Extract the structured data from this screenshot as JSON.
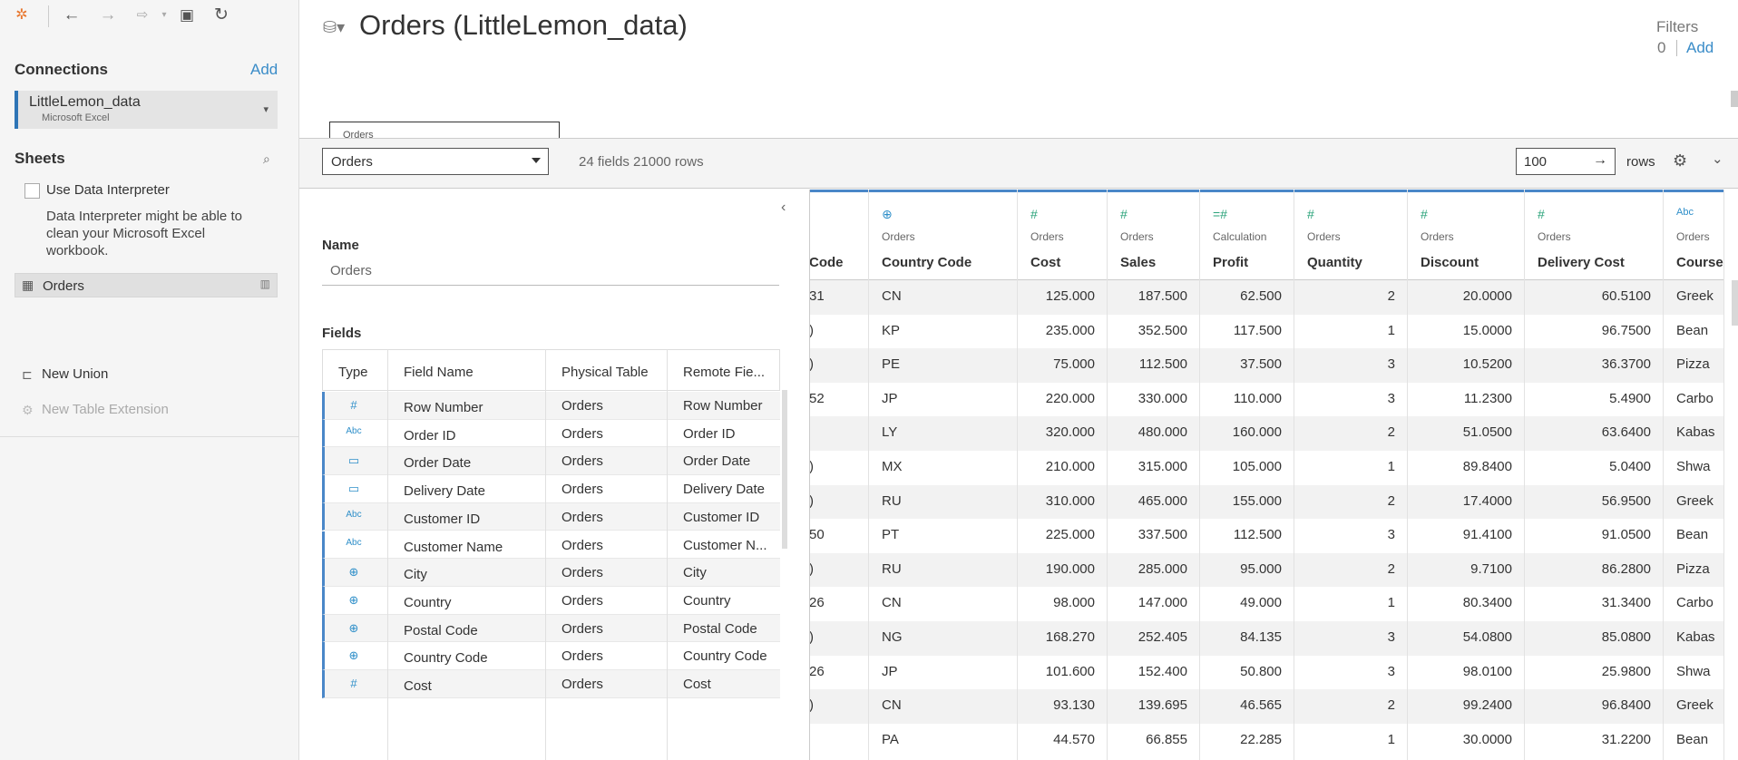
{
  "app": {
    "title": "Orders (LittleLemon_data)"
  },
  "left_panel": {
    "connections_title": "Connections",
    "add_label": "Add",
    "connection": {
      "name": "LittleLemon_data",
      "type": "Microsoft Excel"
    },
    "sheets_title": "Sheets",
    "use_interpreter_label": "Use Data Interpreter",
    "interpreter_note": "Data Interpreter might be able to clean your Microsoft Excel workbook.",
    "sheet_item": "Orders",
    "new_union": "New Union",
    "new_table_extension": "New Table Extension"
  },
  "filters": {
    "label": "Filters",
    "count": "0",
    "add_label": "Add"
  },
  "canvas": {
    "tab_label": "Orders"
  },
  "toolbar": {
    "table_select": "Orders",
    "fields_summary": "24 fields 21000 rows",
    "rows_value": "100",
    "rows_arrow": "→",
    "rows_label": "rows"
  },
  "metadata": {
    "name_label": "Name",
    "name_value": "Orders",
    "fields_label": "Fields",
    "columns": [
      "Type",
      "Field Name",
      "Physical Table",
      "Remote Fie..."
    ],
    "fields": [
      {
        "type": "#",
        "name": "Row Number",
        "physical": "Orders",
        "remote": "Row Number"
      },
      {
        "type": "Abc",
        "name": "Order ID",
        "physical": "Orders",
        "remote": "Order ID"
      },
      {
        "type": "date",
        "name": "Order Date",
        "physical": "Orders",
        "remote": "Order Date"
      },
      {
        "type": "date",
        "name": "Delivery Date",
        "physical": "Orders",
        "remote": "Delivery Date"
      },
      {
        "type": "Abc",
        "name": "Customer ID",
        "physical": "Orders",
        "remote": "Customer ID"
      },
      {
        "type": "Abc",
        "name": "Customer Name",
        "physical": "Orders",
        "remote": "Customer N..."
      },
      {
        "type": "geo",
        "name": "City",
        "physical": "Orders",
        "remote": "City"
      },
      {
        "type": "geo",
        "name": "Country",
        "physical": "Orders",
        "remote": "Country"
      },
      {
        "type": "geo",
        "name": "Postal Code",
        "physical": "Orders",
        "remote": "Postal Code"
      },
      {
        "type": "geo",
        "name": "Country Code",
        "physical": "Orders",
        "remote": "Country Code"
      },
      {
        "type": "#",
        "name": "Cost",
        "physical": "Orders",
        "remote": "Cost"
      }
    ]
  },
  "grid": {
    "columns": [
      {
        "source": "",
        "name": "Code",
        "icon": "",
        "align": "left"
      },
      {
        "source": "Orders",
        "name": "Country Code",
        "icon": "geo",
        "align": "left"
      },
      {
        "source": "Orders",
        "name": "Cost",
        "icon": "#",
        "align": "right"
      },
      {
        "source": "Orders",
        "name": "Sales",
        "icon": "#",
        "align": "right"
      },
      {
        "source": "Calculation",
        "name": "Profit",
        "icon": "=#",
        "align": "right"
      },
      {
        "source": "Orders",
        "name": "Quantity",
        "icon": "#",
        "align": "right"
      },
      {
        "source": "Orders",
        "name": "Discount",
        "icon": "#",
        "align": "right"
      },
      {
        "source": "Orders",
        "name": "Delivery Cost",
        "icon": "#",
        "align": "right"
      },
      {
        "source": "Orders",
        "name": "Course",
        "icon": "Abc",
        "align": "left"
      }
    ],
    "rows": [
      [
        "31",
        "CN",
        "125.000",
        "187.500",
        "62.500",
        "2",
        "20.0000",
        "60.5100",
        "Greek"
      ],
      [
        ")",
        "KP",
        "235.000",
        "352.500",
        "117.500",
        "1",
        "15.0000",
        "96.7500",
        "Bean"
      ],
      [
        ")",
        "PE",
        "75.000",
        "112.500",
        "37.500",
        "3",
        "10.5200",
        "36.3700",
        "Pizza"
      ],
      [
        "52",
        "JP",
        "220.000",
        "330.000",
        "110.000",
        "3",
        "11.2300",
        "5.4900",
        "Carbo"
      ],
      [
        "",
        "LY",
        "320.000",
        "480.000",
        "160.000",
        "2",
        "51.0500",
        "63.6400",
        "Kabas"
      ],
      [
        ")",
        "MX",
        "210.000",
        "315.000",
        "105.000",
        "1",
        "89.8400",
        "5.0400",
        "Shwa"
      ],
      [
        ")",
        "RU",
        "310.000",
        "465.000",
        "155.000",
        "2",
        "17.4000",
        "56.9500",
        "Greek"
      ],
      [
        "50",
        "PT",
        "225.000",
        "337.500",
        "112.500",
        "3",
        "91.4100",
        "91.0500",
        "Bean"
      ],
      [
        ")",
        "RU",
        "190.000",
        "285.000",
        "95.000",
        "2",
        "9.7100",
        "86.2800",
        "Pizza"
      ],
      [
        "26",
        "CN",
        "98.000",
        "147.000",
        "49.000",
        "1",
        "80.3400",
        "31.3400",
        "Carbo"
      ],
      [
        ")",
        "NG",
        "168.270",
        "252.405",
        "84.135",
        "3",
        "54.0800",
        "85.0800",
        "Kabas"
      ],
      [
        "26",
        "JP",
        "101.600",
        "152.400",
        "50.800",
        "3",
        "98.0100",
        "25.9800",
        "Shwa"
      ],
      [
        ")",
        "CN",
        "93.130",
        "139.695",
        "46.565",
        "2",
        "99.2400",
        "96.8400",
        "Greek"
      ],
      [
        "",
        "PA",
        "44.570",
        "66.855",
        "22.285",
        "1",
        "30.0000",
        "31.2200",
        "Bean"
      ]
    ]
  }
}
